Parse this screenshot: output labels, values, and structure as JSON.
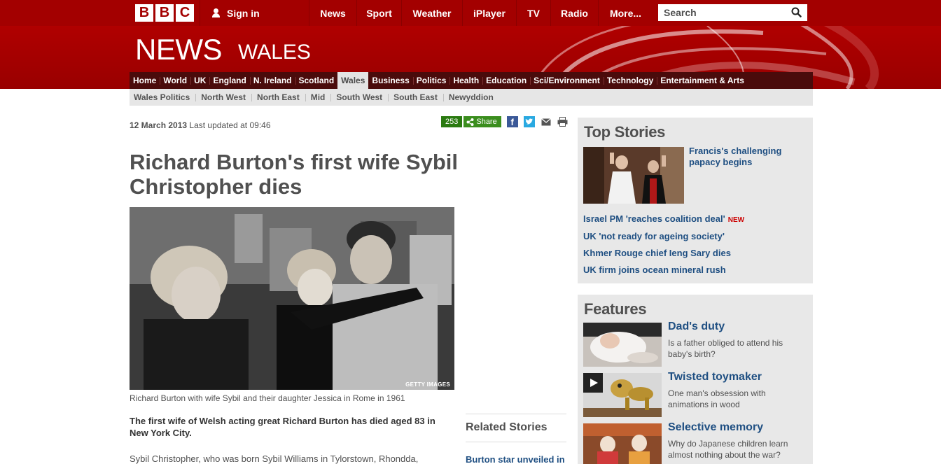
{
  "topbar": {
    "logo": [
      "B",
      "B",
      "C"
    ],
    "signin_label": "Sign in",
    "nav": [
      "News",
      "Sport",
      "Weather",
      "iPlayer",
      "TV",
      "Radio",
      "More..."
    ],
    "search_placeholder": "Search"
  },
  "masthead": {
    "brand": "NEWS",
    "edition": "WALES"
  },
  "section_nav": {
    "items": [
      "Home",
      "World",
      "UK",
      "England",
      "N. Ireland",
      "Scotland",
      "Wales",
      "Business",
      "Politics",
      "Health",
      "Education",
      "Sci/Environment",
      "Technology",
      "Entertainment & Arts"
    ],
    "active": "Wales"
  },
  "sub_nav": {
    "items": [
      "Wales Politics",
      "North West",
      "North East",
      "Mid",
      "South West",
      "South East",
      "Newyddion"
    ]
  },
  "story": {
    "date": "12 March 2013",
    "updated": "Last updated at 09:46",
    "share_count": "253",
    "share_label": "Share",
    "headline": "Richard Burton's first wife Sybil Christopher dies",
    "photo_credit": "GETTY IMAGES",
    "caption": "Richard Burton with wife Sybil and their daughter Jessica in Rome in 1961",
    "intro": "The first wife of Welsh acting great Richard Burton has died aged 83 in New York City.",
    "body_start": "Sybil Christopher, who was born Sybil Williams in Tylorstown, Rhondda,"
  },
  "related": {
    "title": "Related Stories",
    "links": [
      "Burton star unveiled in"
    ]
  },
  "top_stories": {
    "title": "Top Stories",
    "lead": "Francis's challenging papacy begins",
    "links": [
      {
        "text": "Israel PM 'reaches coalition deal'",
        "badge": "NEW"
      },
      {
        "text": "UK 'not ready for ageing society'",
        "badge": ""
      },
      {
        "text": "Khmer Rouge chief Ieng Sary dies",
        "badge": ""
      },
      {
        "text": "UK firm joins ocean mineral rush",
        "badge": ""
      }
    ]
  },
  "features": {
    "title": "Features",
    "items": [
      {
        "title": "Dad's duty",
        "desc": "Is a father obliged to attend his baby's birth?"
      },
      {
        "title": "Twisted toymaker",
        "desc": "One man's obsession with animations in wood"
      },
      {
        "title": "Selective memory",
        "desc": "Why do Japanese children learn almost nothing about the war?"
      }
    ]
  },
  "colors": {
    "brand_red": "#a30000",
    "link_blue": "#1f4f82",
    "share_green": "#3b8e1e"
  }
}
